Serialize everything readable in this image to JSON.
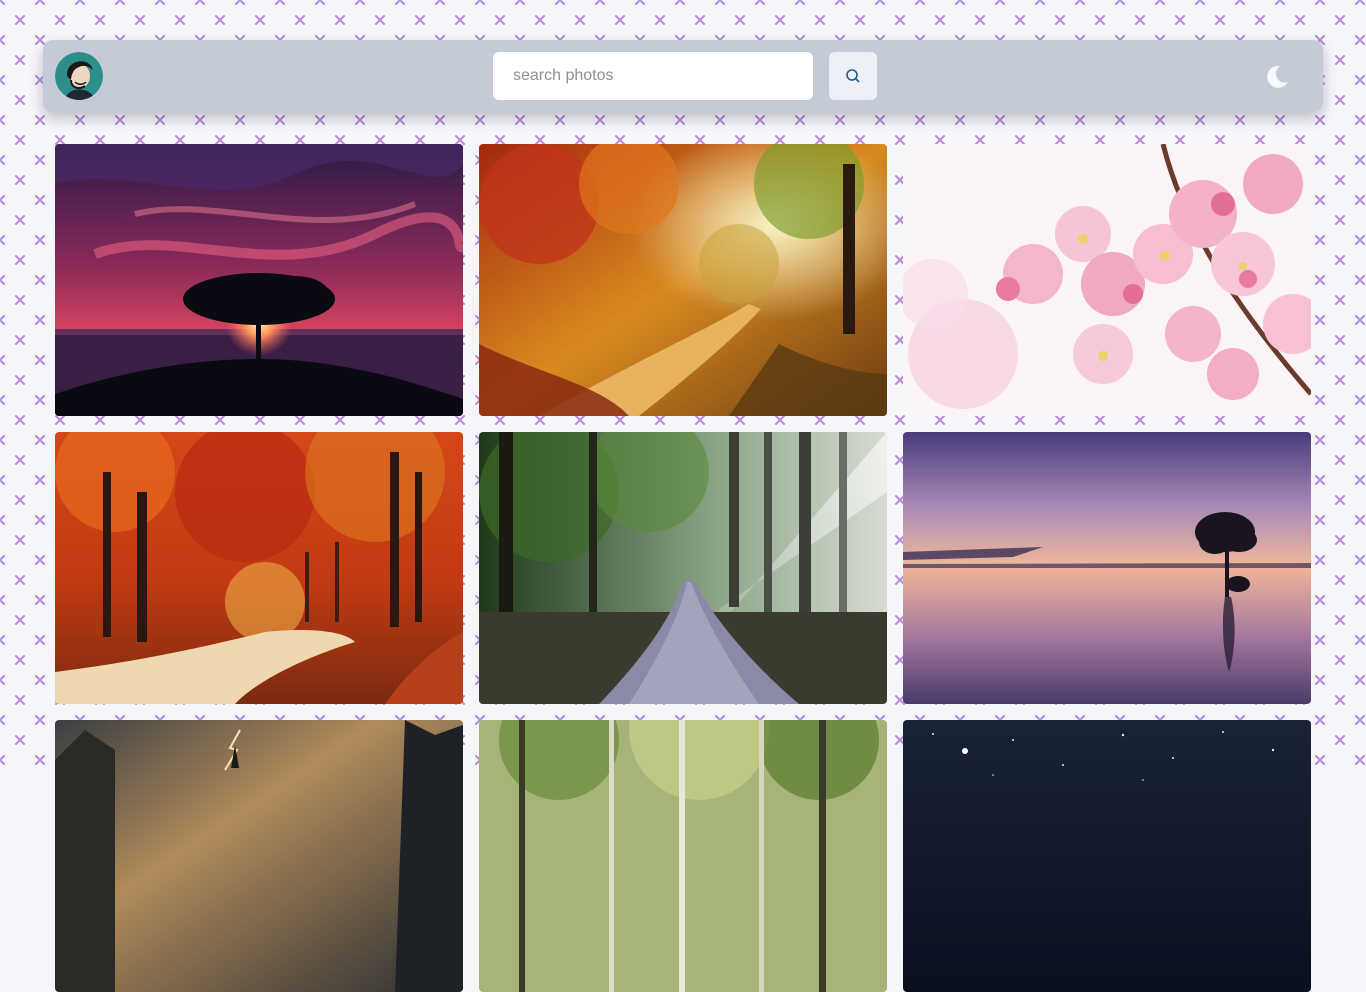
{
  "header": {
    "avatar_icon": "user-avatar",
    "search": {
      "placeholder": "search photos",
      "value": ""
    },
    "search_button_icon": "search-icon",
    "theme_toggle_icon": "moon-icon"
  },
  "colors": {
    "header_bg": "#c5cad7",
    "page_bg": "#f5f6fa",
    "pattern_mark": "#b48ad6",
    "search_button_bg": "#edf0f6",
    "search_icon": "#1f5f86"
  },
  "gallery": {
    "photos": [
      {
        "subject": "tree-silhouette-sunset"
      },
      {
        "subject": "autumn-forest-path"
      },
      {
        "subject": "pink-cherry-blossoms"
      },
      {
        "subject": "red-autumn-forest-road"
      },
      {
        "subject": "misty-forest-path"
      },
      {
        "subject": "tree-in-lake-dusk"
      },
      {
        "subject": "lightning-storm-mountains"
      },
      {
        "subject": "green-birch-forest"
      },
      {
        "subject": "starry-night-sky"
      }
    ]
  }
}
